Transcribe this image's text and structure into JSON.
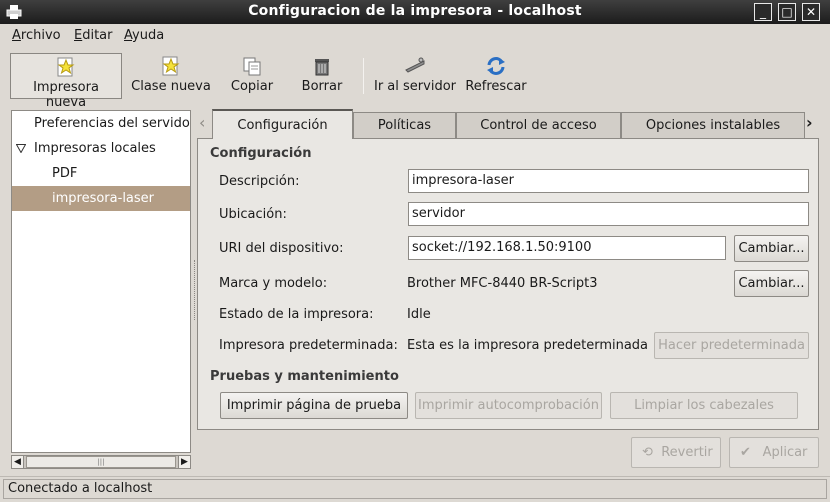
{
  "window": {
    "title": "Configuracion de la impresora - localhost"
  },
  "menu": {
    "items": [
      "Archivo",
      "Editar",
      "Ayuda"
    ]
  },
  "toolbar": {
    "new_printer": "Impresora nueva",
    "new_class": "Clase nueva",
    "copy": "Copiar",
    "delete": "Borrar",
    "goto_server": "Ir al servidor",
    "refresh": "Refrescar"
  },
  "tree": {
    "server_settings": "Preferencias del servidor",
    "local_printers": "Impresoras locales",
    "items": [
      "PDF",
      "impresora-laser"
    ],
    "selected": "impresora-laser"
  },
  "tabs": [
    "Configuración",
    "Políticas",
    "Control de acceso",
    "Opciones instalables"
  ],
  "settings": {
    "section_title": "Configuración",
    "description_label": "Descripción:",
    "description_value": "impresora-laser",
    "location_label": "Ubicación:",
    "location_value": "servidor",
    "uri_label": "URI del dispositivo:",
    "uri_value": "socket://192.168.1.50:9100",
    "change_button": "Cambiar...",
    "make_model_label": "Marca y modelo:",
    "make_model_value": "Brother MFC-8440 BR-Script3",
    "state_label": "Estado de la impresora:",
    "state_value": "Idle",
    "default_label": "Impresora predeterminada:",
    "default_value": "Esta es la impresora predeterminada",
    "make_default_button": "Hacer predeterminada",
    "maintenance_title": "Pruebas y mantenimiento",
    "print_test_page": "Imprimir página de prueba",
    "print_self_test": "Imprimir autocomprobación",
    "clean_heads": "Limpiar los cabezales"
  },
  "actions": {
    "revert": "Revertir",
    "apply": "Aplicar"
  },
  "status": {
    "text": "Conectado a localhost"
  },
  "colors": {
    "selection": "#b39d85",
    "titlebar": "#2b2b2b"
  }
}
